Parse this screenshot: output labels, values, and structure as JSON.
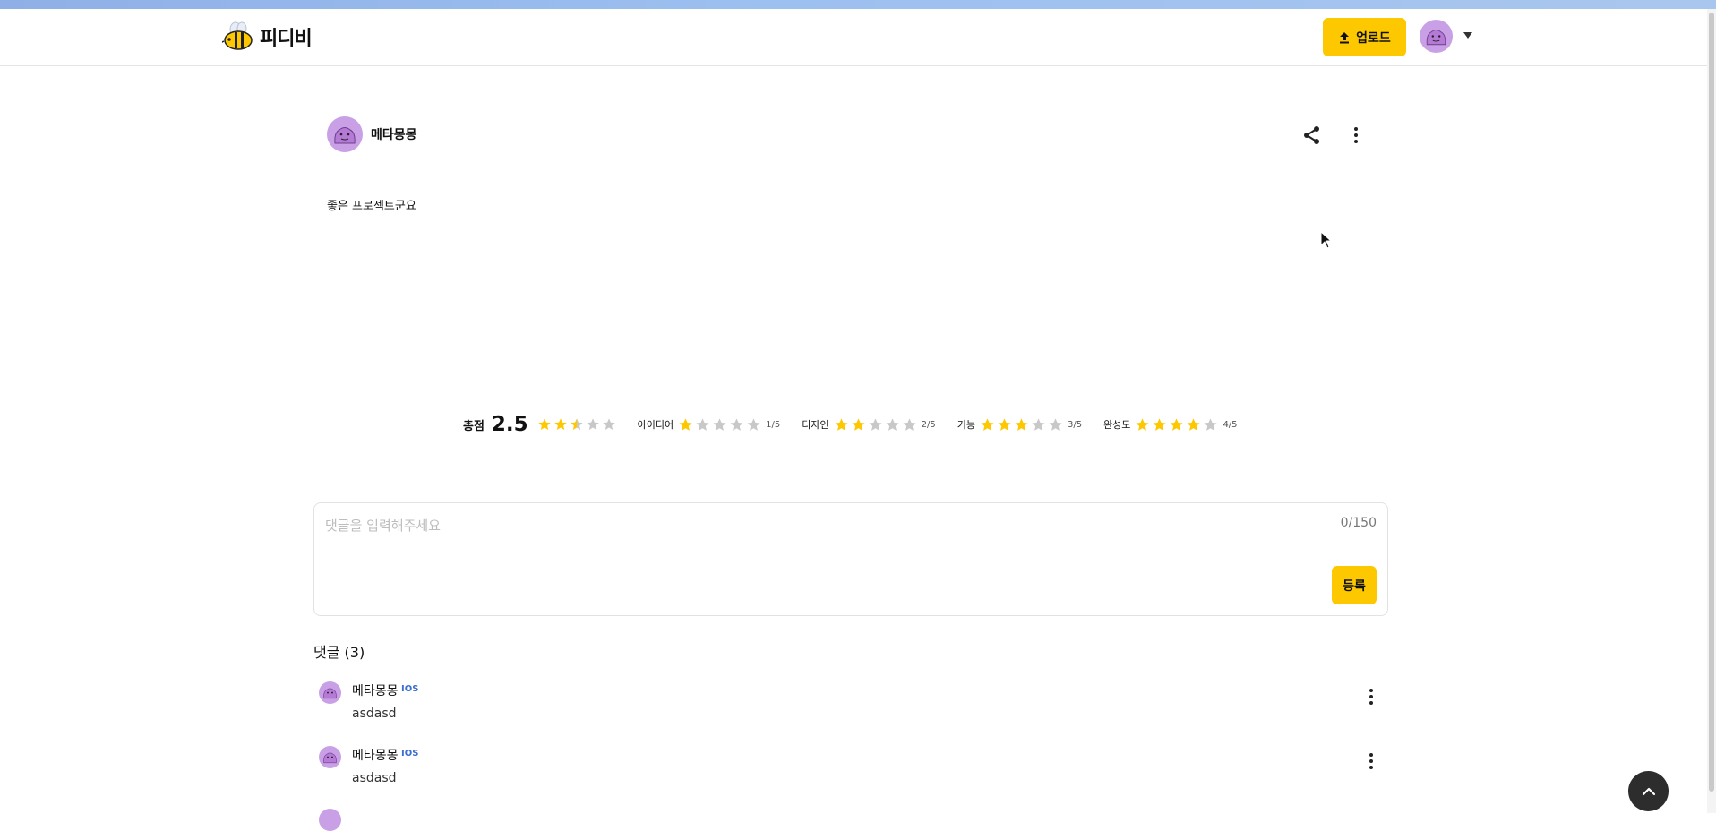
{
  "header": {
    "logo_text": "피디비",
    "upload_label": "업로드",
    "icons": {
      "logo": "bee-logo-icon",
      "upload": "upload-icon",
      "avatar": "user-avatar",
      "caret": "caret-down-icon"
    }
  },
  "review": {
    "author": "메타몽몽",
    "text": "좋은 프로젝트군요",
    "icons": {
      "share": "share-icon",
      "more": "more-vertical-icon"
    }
  },
  "ratings": {
    "total_label": "총점",
    "total_score": "2.5",
    "total_stars": 2.5,
    "items": [
      {
        "label": "아이디어",
        "score": "1/5",
        "stars": 1
      },
      {
        "label": "디자인",
        "score": "2/5",
        "stars": 2
      },
      {
        "label": "기능",
        "score": "3/5",
        "stars": 3
      },
      {
        "label": "완성도",
        "score": "4/5",
        "stars": 4
      }
    ],
    "colors": {
      "filled": "#fdc800",
      "empty": "#c8c8c8"
    }
  },
  "comment_form": {
    "placeholder": "댓글을 입력해주세요",
    "value": "",
    "counter": "0/150",
    "submit_label": "등록"
  },
  "comments": {
    "title": "댓글 (3)",
    "items": [
      {
        "author": "메타몽몽",
        "badge": "IOS",
        "text": "asdasd"
      },
      {
        "author": "메타몽몽",
        "badge": "IOS",
        "text": "asdasd"
      }
    ]
  },
  "colors": {
    "accent": "#fdc800",
    "badge": "#3b6fd1",
    "fab": "#2d2d2d"
  }
}
